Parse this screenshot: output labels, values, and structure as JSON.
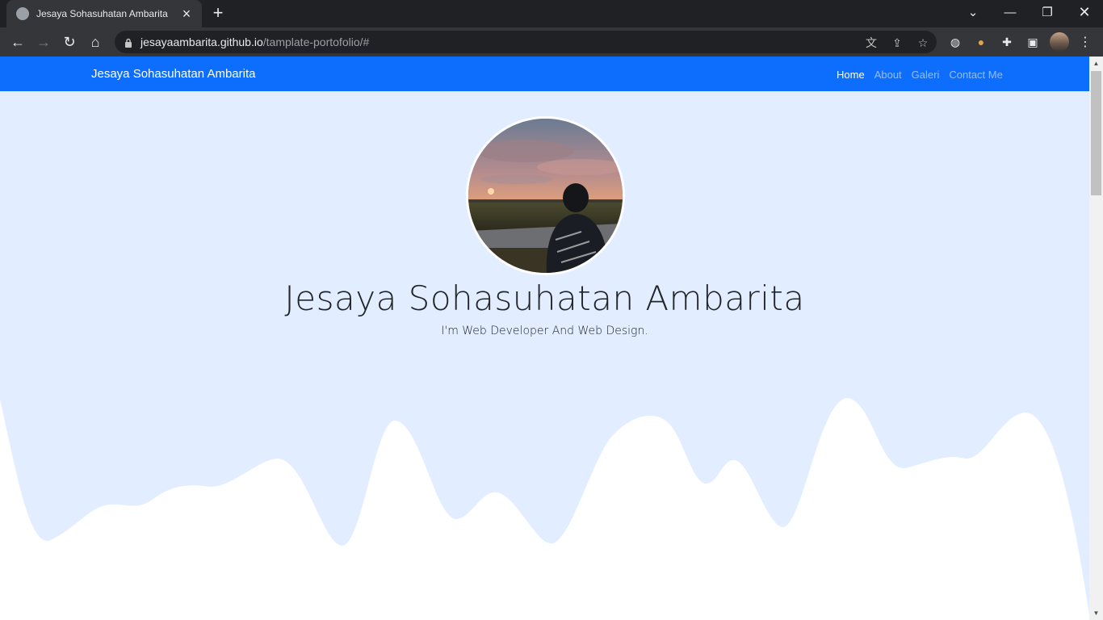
{
  "browser": {
    "tab_title": "Jesaya Sohasuhatan Ambarita",
    "url_host": "jesayaambarita.github.io",
    "url_path": "/tamplate-portofolio/#",
    "icons": {
      "favicon": "globe-icon",
      "close": "close-icon",
      "new_tab": "plus-icon",
      "tab_search": "chevron-down-icon",
      "minimize": "minimize-icon",
      "restore": "restore-icon",
      "window_close": "close-icon",
      "back": "arrow-left-icon",
      "forward": "arrow-right-icon",
      "reload": "reload-icon",
      "home": "home-icon",
      "lock": "lock-icon",
      "translate": "translate-icon",
      "share": "share-icon",
      "bookmark": "star-icon",
      "ext_globe": "globe-icon",
      "ext_cookie": "cookie-icon",
      "extensions": "puzzle-icon",
      "side_panel": "side-panel-icon",
      "menu": "kebab-menu-icon"
    }
  },
  "site": {
    "brand": "Jesaya Sohasuhatan Ambarita",
    "nav": [
      {
        "label": "Home",
        "active": true
      },
      {
        "label": "About",
        "active": false
      },
      {
        "label": "Galeri",
        "active": false
      },
      {
        "label": "Contact Me",
        "active": false
      }
    ],
    "hero": {
      "name": "Jesaya Sohasuhatan Ambarita",
      "tagline": "I'm Web Developer And Web Design."
    },
    "colors": {
      "navbar": "#0d6efd",
      "hero_bg": "#e2edff",
      "wave": "#ffffff"
    }
  }
}
